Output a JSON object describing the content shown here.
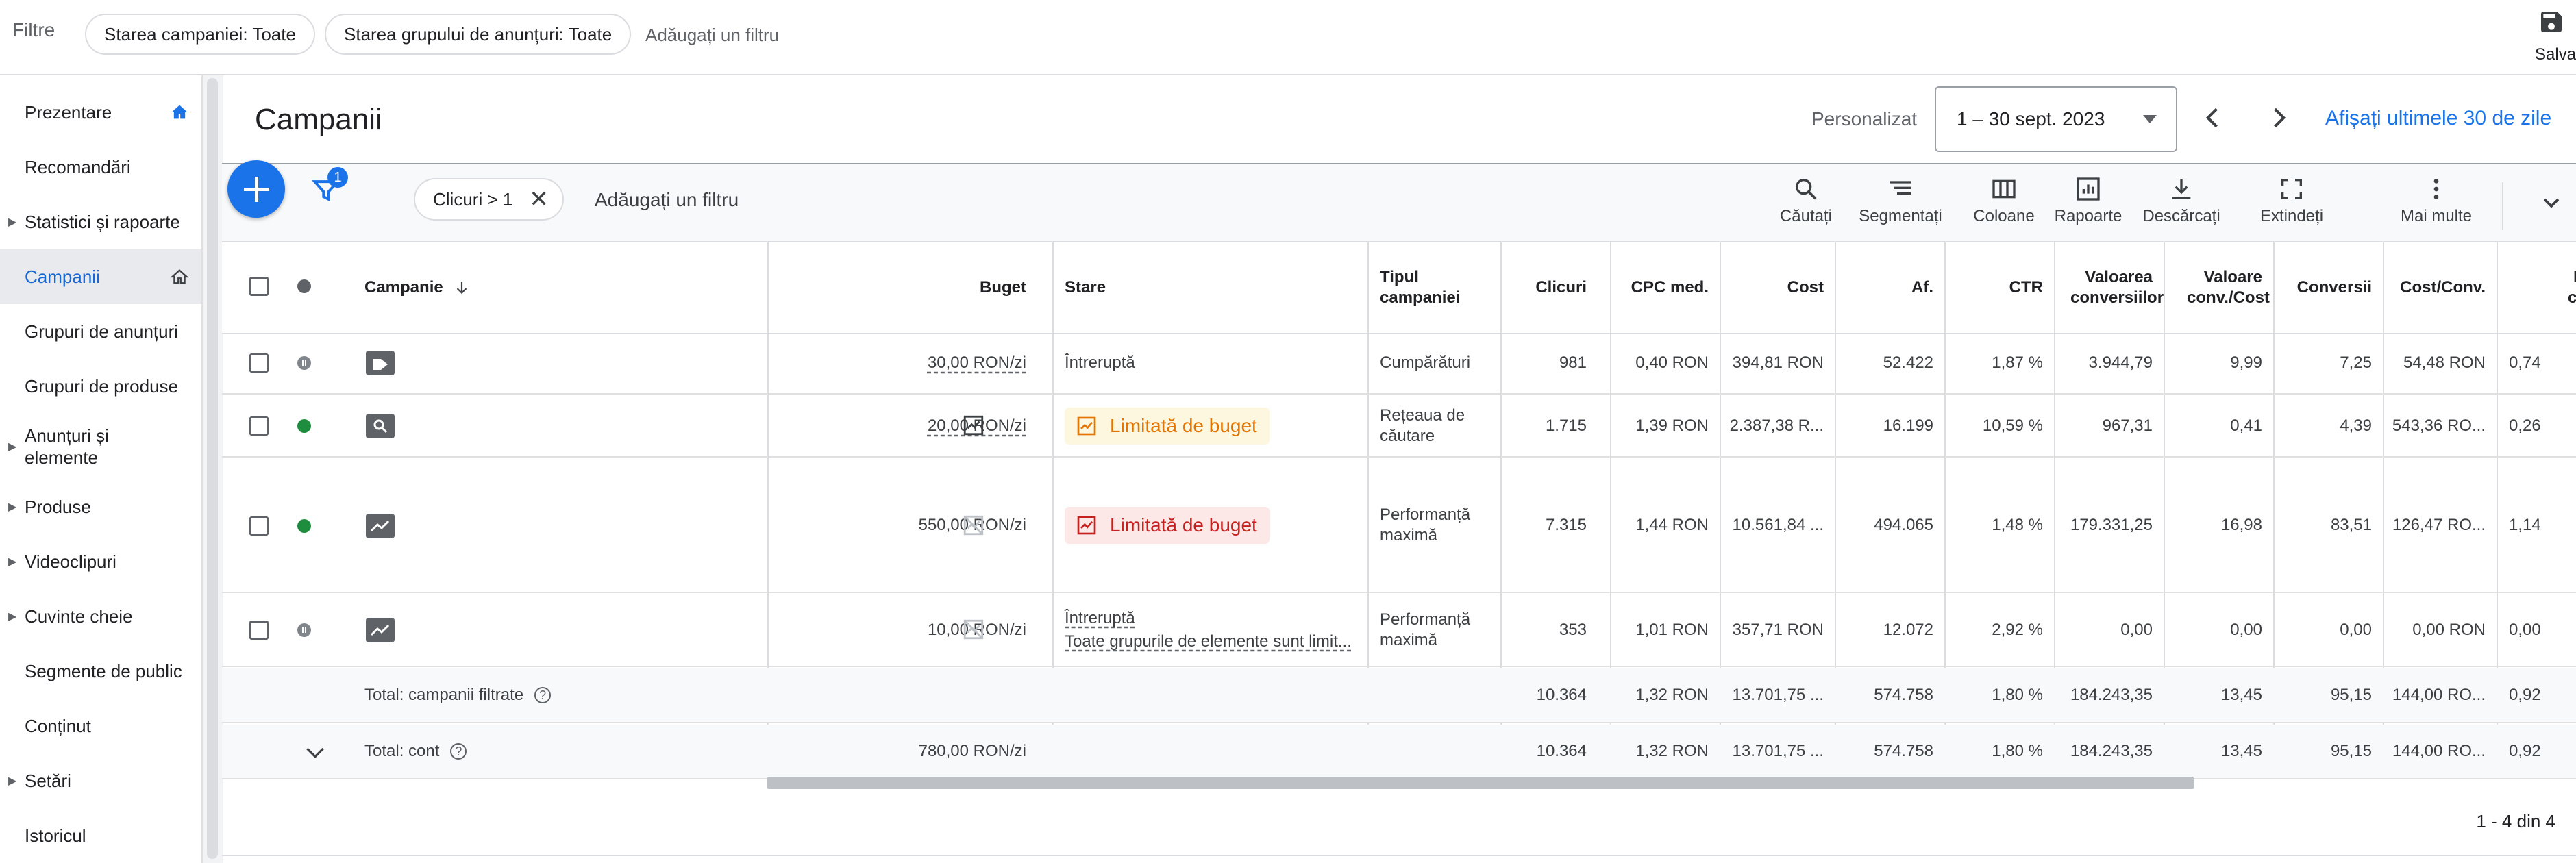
{
  "filterbar": {
    "label": "Filtre",
    "chips": [
      "Starea campaniei: Toate",
      "Starea grupului de anunțuri: Toate"
    ],
    "add_filter": "Adăugați un filtru",
    "save_label": "Salvați"
  },
  "sidebar": {
    "items": [
      {
        "label": "Prezentare",
        "caret": false,
        "home": true,
        "active": false
      },
      {
        "label": "Recomandări",
        "caret": false,
        "home": false,
        "active": false
      },
      {
        "label": "Statistici și rapoarte",
        "caret": true,
        "home": false,
        "active": false
      },
      {
        "label": "Campanii",
        "caret": false,
        "home": true,
        "active": true
      },
      {
        "label": "Grupuri de anunțuri",
        "caret": false,
        "home": false,
        "active": false
      },
      {
        "label": "Grupuri de produse",
        "caret": false,
        "home": false,
        "active": false
      },
      {
        "label": "Anunțuri și elemente",
        "caret": true,
        "home": false,
        "active": false
      },
      {
        "label": "Produse",
        "caret": true,
        "home": false,
        "active": false
      },
      {
        "label": "Videoclipuri",
        "caret": true,
        "home": false,
        "active": false
      },
      {
        "label": "Cuvinte cheie",
        "caret": true,
        "home": false,
        "active": false
      },
      {
        "label": "Segmente de public",
        "caret": false,
        "home": false,
        "active": false
      },
      {
        "label": "Conținut",
        "caret": false,
        "home": false,
        "active": false
      },
      {
        "label": "Setări",
        "caret": true,
        "home": false,
        "active": false
      },
      {
        "label": "Istoricul",
        "caret": false,
        "home": false,
        "active": false
      }
    ]
  },
  "header": {
    "title": "Campanii",
    "date_label": "Personalizat",
    "date_range": "1 – 30 sept. 2023",
    "last30": "Afișați ultimele 30 de zile"
  },
  "toolbar": {
    "filter_count": "1",
    "active_filter": "Clicuri > 1",
    "add_filter": "Adăugați un filtru",
    "buttons": [
      "Căutați",
      "Segmentați",
      "Coloane",
      "Rapoarte",
      "Descărcați",
      "Extindeți",
      "Mai multe"
    ]
  },
  "table": {
    "columns": {
      "campaign": "Campanie",
      "budget": "Buget",
      "status": "Stare",
      "type": "Tipul campaniei",
      "clicks": "Clicuri",
      "cpc": "CPC med.",
      "cost": "Cost",
      "impr": "Af.",
      "ctr": "CTR",
      "conv_value": "Valoarea conversiilor",
      "conv_value_cost": "Valoare conv./Cost",
      "conversions": "Conversii",
      "cost_conv": "Cost/Conv.",
      "conv_rate": "Rata conv."
    },
    "rows": [
      {
        "status_dot": "paused",
        "type_icon": "shopping-tag-icon",
        "budget": "30,00 RON/zi",
        "status": "Întreruptă",
        "status_sub": "",
        "limited": "",
        "type": "Cumpărături",
        "clicks": "981",
        "cpc": "0,40 RON",
        "cost": "394,81 RON",
        "impr": "52.422",
        "ctr": "1,87 %",
        "conv_value": "3.944,79",
        "conv_value_cost": "9,99",
        "conversions": "7,25",
        "cost_conv": "54,48 RON",
        "conv_rate": "0,74"
      },
      {
        "status_dot": "green",
        "type_icon": "search-icon",
        "budget": "20,00 RON/zi",
        "status": "",
        "status_sub": "",
        "limited": "Limitată de buget",
        "type": "Rețeaua de căutare",
        "clicks": "1.715",
        "cpc": "1,39 RON",
        "cost": "2.387,38 R...",
        "impr": "16.199",
        "ctr": "10,59 %",
        "conv_value": "967,31",
        "conv_value_cost": "0,41",
        "conversions": "4,39",
        "cost_conv": "543,36 RO...",
        "conv_rate": "0,26"
      },
      {
        "status_dot": "green",
        "type_icon": "performance-icon",
        "budget": "550,00 RON/zi",
        "status": "",
        "status_sub": "",
        "limited": "Limitată de buget",
        "type": "Performanță maximă",
        "clicks": "7.315",
        "cpc": "1,44 RON",
        "cost": "10.561,84 ...",
        "impr": "494.065",
        "ctr": "1,48 %",
        "conv_value": "179.331,25",
        "conv_value_cost": "16,98",
        "conversions": "83,51",
        "cost_conv": "126,47 RO...",
        "conv_rate": "1,14"
      },
      {
        "status_dot": "paused",
        "type_icon": "performance-icon",
        "budget": "10,00 RON/zi",
        "status": "Întreruptă",
        "status_sub": "Toate grupurile de elemente sunt limit...",
        "limited": "",
        "type": "Performanță maximă",
        "clicks": "353",
        "cpc": "1,01 RON",
        "cost": "357,71 RON",
        "impr": "12.072",
        "ctr": "2,92 %",
        "conv_value": "0,00",
        "conv_value_cost": "0,00",
        "conversions": "0,00",
        "cost_conv": "0,00 RON",
        "conv_rate": "0,00"
      }
    ],
    "totals": [
      {
        "label": "Total: campanii filtrate",
        "budget": "",
        "clicks": "10.364",
        "cpc": "1,32 RON",
        "cost": "13.701,75 ...",
        "impr": "574.758",
        "ctr": "1,80 %",
        "conv_value": "184.243,35",
        "conv_value_cost": "13,45",
        "conversions": "95,15",
        "cost_conv": "144,00 RO...",
        "conv_rate": "0,92"
      },
      {
        "label": "Total: cont",
        "budget": "780,00 RON/zi",
        "clicks": "10.364",
        "cpc": "1,32 RON",
        "cost": "13.701,75 ...",
        "impr": "574.758",
        "ctr": "1,80 %",
        "conv_value": "184.243,35",
        "conv_value_cost": "13,45",
        "conversions": "95,15",
        "cost_conv": "144,00 RO...",
        "conv_rate": "0,92"
      }
    ],
    "pagination": "1 - 4 din 4"
  },
  "colors": {
    "accent": "#1a73e8",
    "active_nav": "#1967d2",
    "enabled": "#1e8e3e",
    "limited_orange": "#e37400",
    "limited_red": "#c5221f"
  }
}
